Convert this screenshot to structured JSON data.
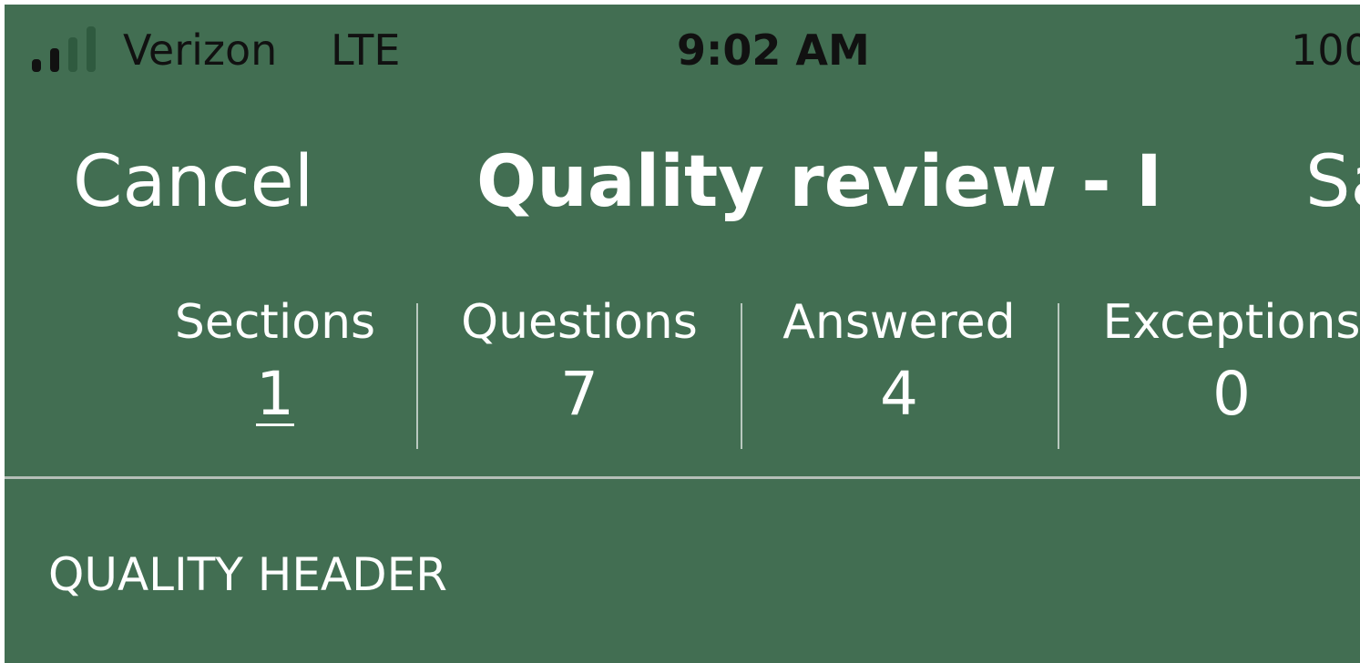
{
  "status_bar": {
    "carrier": "Verizon",
    "network": "LTE",
    "time": "9:02 AM",
    "battery": "100",
    "signal_bars": 2,
    "signal_bars_total": 4
  },
  "nav": {
    "cancel_label": "Cancel",
    "title": "Quality review - I",
    "save_label": "Sa"
  },
  "stats": [
    {
      "label": "Sections",
      "value": "1"
    },
    {
      "label": "Questions",
      "value": "7"
    },
    {
      "label": "Answered",
      "value": "4"
    },
    {
      "label": "Exceptions",
      "value": "0"
    }
  ],
  "section": {
    "header": "QUALITY HEADER"
  },
  "colors": {
    "background": "#426e52",
    "text": "#ffffff",
    "status_text": "#111111",
    "signal_active": "#111111",
    "signal_inactive": "#2f5a3f"
  }
}
